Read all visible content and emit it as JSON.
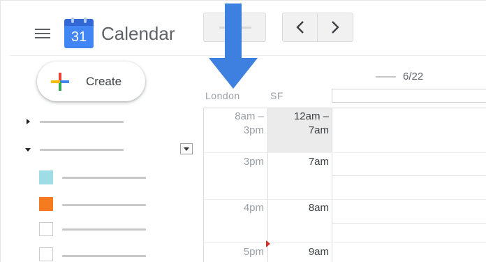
{
  "header": {
    "logo_number": "31",
    "app_title": "Calendar"
  },
  "sidebar": {
    "create_label": "Create",
    "calendar_colors": [
      "#9fdde6",
      "#f47b20",
      "#ffffff",
      "#ffffff"
    ]
  },
  "main": {
    "date_label": "6/22",
    "timezones": [
      "London",
      "SF"
    ],
    "time_rows": [
      {
        "london": "8am –\n3pm",
        "sf": "12am –\n7am"
      },
      {
        "london": "3pm",
        "sf": "7am"
      },
      {
        "london": "4pm",
        "sf": "8am"
      },
      {
        "london": "5pm",
        "sf": "9am"
      }
    ]
  },
  "overlay": {
    "arrow_color": "#3d80e0",
    "arrow_direction": "down"
  },
  "colors": {
    "brand_blue": "#4285f4",
    "now_marker": "#d93025"
  }
}
